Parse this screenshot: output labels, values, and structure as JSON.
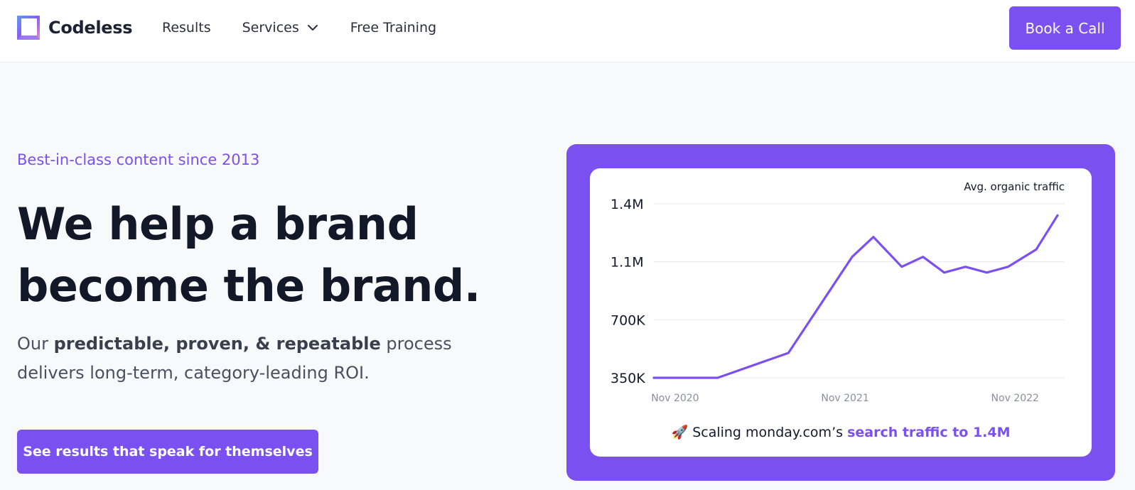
{
  "header": {
    "logo_text": "Codeless",
    "nav": [
      {
        "label": "Results"
      },
      {
        "label": "Services",
        "has_dropdown": true
      },
      {
        "label": "Free Training"
      }
    ],
    "cta_label": "Book a Call"
  },
  "hero": {
    "eyebrow": "Best-in-class content since 2013",
    "headline_line1": "We help a brand",
    "headline_line2": "become the brand.",
    "sub_prefix": "Our ",
    "sub_bold": "predictable, proven, & repeatable",
    "sub_suffix": " process delivers long-term, category-leading ROI.",
    "cta_label": "See results that speak for themselves"
  },
  "card": {
    "caption_emoji": "🚀",
    "caption_prefix": "Scaling monday.com’s",
    "caption_highlight": "search traffic to 1.4M"
  },
  "colors": {
    "brand": "#7b50f1",
    "text_dark": "#121828",
    "grid": "#e6e8ee"
  },
  "icons": {
    "logo": "codeless-logo-icon",
    "services_dropdown": "chevron-down-icon",
    "caption": "rocket-icon"
  },
  "chart_data": {
    "type": "line",
    "legend": "Avg. organic traffic",
    "yticks": [
      {
        "label": "350K",
        "value": 350000
      },
      {
        "label": "700K",
        "value": 700000
      },
      {
        "label": "1.1M",
        "value": 1050000
      },
      {
        "label": "1.4M",
        "value": 1400000
      }
    ],
    "ylim": [
      350000,
      1400000
    ],
    "xticks": [
      {
        "label": "Nov 2020",
        "value": 0
      },
      {
        "label": "Nov 2021",
        "value": 12
      },
      {
        "label": "Nov 2022",
        "value": 24
      }
    ],
    "xlim": [
      -1.5,
      27.5
    ],
    "grid": true,
    "series": [
      {
        "x": [
          -1.5,
          3,
          8,
          12.5,
          14,
          16,
          17.5,
          19,
          20.5,
          22,
          23.5,
          25.5,
          27
        ],
        "y": [
          350000,
          350000,
          500000,
          1080000,
          1200000,
          1020000,
          1080000,
          985000,
          1020000,
          985000,
          1020000,
          1125000,
          1330000
        ]
      }
    ]
  }
}
